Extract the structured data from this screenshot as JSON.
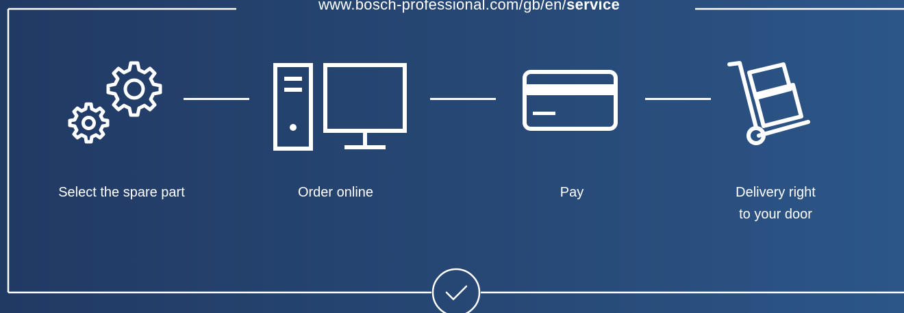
{
  "header": {
    "url_prefix": "www.bosch-professional.com/gb/en/",
    "url_bold": "service"
  },
  "steps": [
    {
      "label": "Select the spare part",
      "icon": "gears-icon"
    },
    {
      "label": "Order online",
      "icon": "computer-icon"
    },
    {
      "label": "Pay",
      "icon": "credit-card-icon"
    },
    {
      "label_line1": "Delivery right",
      "label_line2": "to your door",
      "icon": "hand-truck-icon"
    }
  ],
  "footer": {
    "icon": "checkmark-icon"
  },
  "colors": {
    "bg_left": "#213a64",
    "bg_right": "#2c5688",
    "foreground": "#ffffff"
  }
}
